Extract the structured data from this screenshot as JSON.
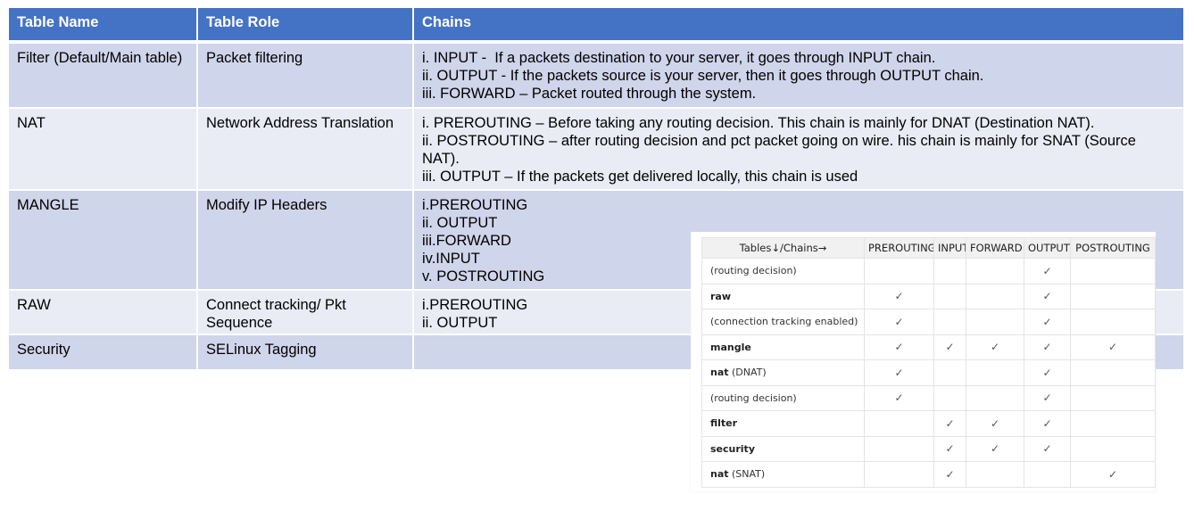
{
  "main_table": {
    "headers": [
      "Table Name",
      "Table Role",
      "Chains"
    ],
    "rows": [
      {
        "name": "Filter (Default/Main table)",
        "role": "Packet filtering",
        "chains": [
          "i. INPUT -  If a packets destination to your server, it goes through INPUT chain.",
          "ii. OUTPUT - If the packets source is your server, then it goes through OUTPUT chain.",
          "iii. FORWARD – Packet routed through the system."
        ]
      },
      {
        "name": "NAT",
        "role": "Network Address Translation",
        "chains": [
          "i. PREROUTING – Before taking any routing decision. This chain is mainly for DNAT (Destination NAT).",
          "ii. POSTROUTING – after routing decision and pct packet going on wire. his chain is mainly for SNAT (Source NAT).",
          "iii. OUTPUT – If the packets get delivered locally, this chain is used"
        ]
      },
      {
        "name": "MANGLE",
        "role": "Modify IP Headers",
        "chains": [
          "i.PREROUTING",
          "ii. OUTPUT",
          "iii.FORWARD",
          "iv.INPUT",
          "v. POSTROUTING"
        ]
      },
      {
        "name": "RAW",
        "role": "Connect tracking/ Pkt Sequence",
        "chains": [
          "i.PREROUTING",
          "ii. OUTPUT"
        ]
      },
      {
        "name": "Security",
        "role": "SELinux Tagging",
        "chains": []
      }
    ]
  },
  "inset_table": {
    "header_label": "Tables↓/Chains→",
    "columns": [
      "PREROUTING",
      "INPUT",
      "FORWARD",
      "OUTPUT",
      "POSTROUTING"
    ],
    "check_glyph": "✓",
    "rows": [
      {
        "bold": "",
        "label": "(routing decision)",
        "checks": [
          false,
          false,
          false,
          true,
          false
        ]
      },
      {
        "bold": "raw",
        "label": "",
        "checks": [
          true,
          false,
          false,
          true,
          false
        ]
      },
      {
        "bold": "",
        "label": "(connection tracking enabled)",
        "checks": [
          true,
          false,
          false,
          true,
          false
        ]
      },
      {
        "bold": "mangle",
        "label": "",
        "checks": [
          true,
          true,
          true,
          true,
          true
        ]
      },
      {
        "bold": "nat",
        "label": " (DNAT)",
        "checks": [
          true,
          false,
          false,
          true,
          false
        ]
      },
      {
        "bold": "",
        "label": "(routing decision)",
        "checks": [
          true,
          false,
          false,
          true,
          false
        ]
      },
      {
        "bold": "filter",
        "label": "",
        "checks": [
          false,
          true,
          true,
          true,
          false
        ]
      },
      {
        "bold": "security",
        "label": "",
        "checks": [
          false,
          true,
          true,
          true,
          false
        ]
      },
      {
        "bold": "nat",
        "label": " (SNAT)",
        "checks": [
          false,
          true,
          false,
          false,
          true
        ]
      }
    ]
  }
}
